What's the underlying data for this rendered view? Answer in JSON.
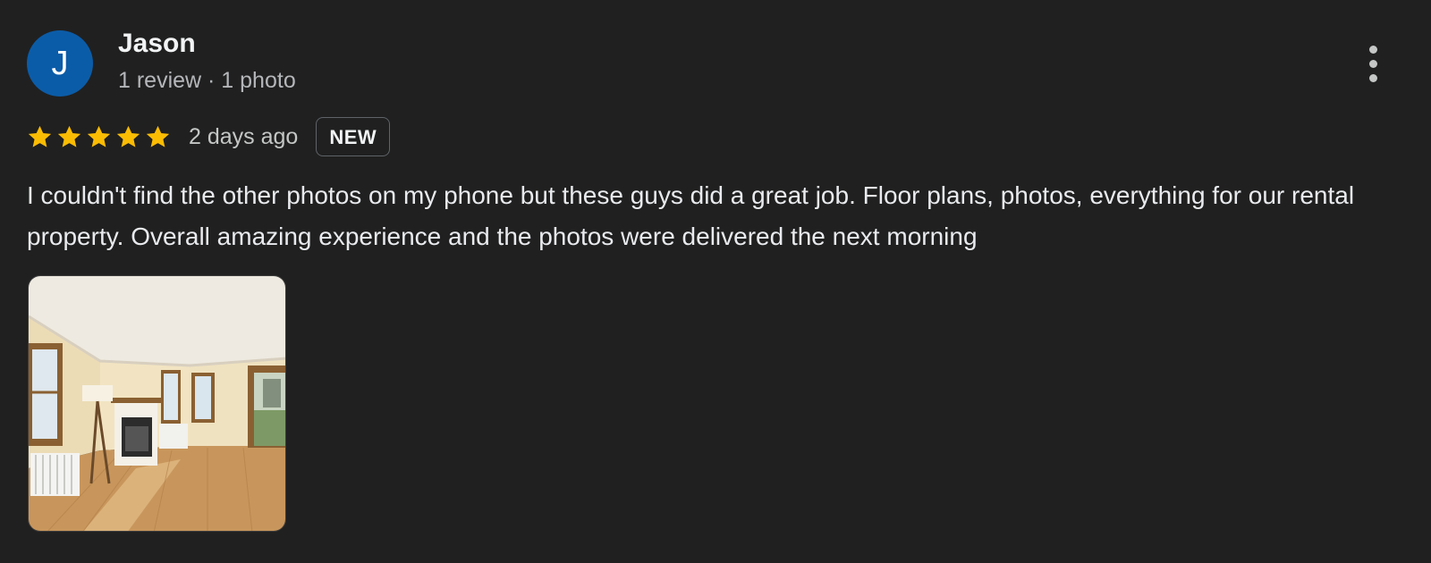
{
  "review": {
    "author": {
      "initial": "J",
      "name": "Jason",
      "meta": "1 review · 1 photo",
      "avatar_color": "#0b5ca8"
    },
    "rating": 5,
    "rating_max": 5,
    "date": "2 days ago",
    "badge": "NEW",
    "text": "I couldn't find the other photos on my phone but these guys did a great job. Floor plans, photos, everything for our rental property. Overall amazing experience and the photos were delivered the next morning",
    "photos": [
      {
        "subject": "living room with fireplace, hardwood floor and windows"
      }
    ],
    "menu_icon": "more-vertical-icon",
    "star_color": "#fbbc04"
  }
}
